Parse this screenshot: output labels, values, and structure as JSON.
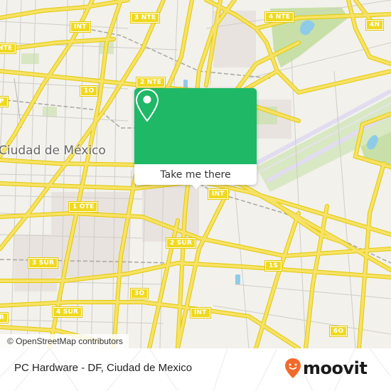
{
  "map": {
    "city_label": "Ciudad de México",
    "colors": {
      "background": "#f2f1ec",
      "road_major": "#f6e266",
      "road_major_casing": "#e4c800",
      "road_minor": "#c9c7c0",
      "park": "#c8e0a8",
      "water": "#8ecbe8",
      "runway": "#e1dcef",
      "built_area": "#e9e3df"
    },
    "route_shields": [
      {
        "id": "int-top",
        "label": "INT"
      },
      {
        "id": "3nte",
        "label": "3 NTE"
      },
      {
        "id": "4nte",
        "label": "4 NTE"
      },
      {
        "id": "4n",
        "label": "4N"
      },
      {
        "id": "nte-left",
        "label": "NTE"
      },
      {
        "id": "2nte",
        "label": "2 NTE"
      },
      {
        "id": "1o",
        "label": "1O"
      },
      {
        "id": "p-left",
        "label": "P"
      },
      {
        "id": "int-mid",
        "label": "INT"
      },
      {
        "id": "1ote",
        "label": "1 OTE"
      },
      {
        "id": "2sur",
        "label": "2 SUR"
      },
      {
        "id": "3sur",
        "label": "3 SUR"
      },
      {
        "id": "1s",
        "label": "1S"
      },
      {
        "id": "3o",
        "label": "3O"
      },
      {
        "id": "4sur",
        "label": "4 SUR"
      },
      {
        "id": "r-left",
        "label": "R"
      },
      {
        "id": "int-bottom",
        "label": "INT"
      },
      {
        "id": "6o",
        "label": "6O"
      }
    ],
    "attribution": "© OpenStreetMap contributors"
  },
  "popup": {
    "icon": "location-pin-icon",
    "action_label": "Take me there",
    "accent": "#1fb866"
  },
  "footer": {
    "place_title": "PC Hardware - DF, Ciudad de Mexico",
    "brand": "moovit",
    "brand_icon": "moovit-smiley-pin-icon",
    "brand_accent": "#f26a2a"
  }
}
